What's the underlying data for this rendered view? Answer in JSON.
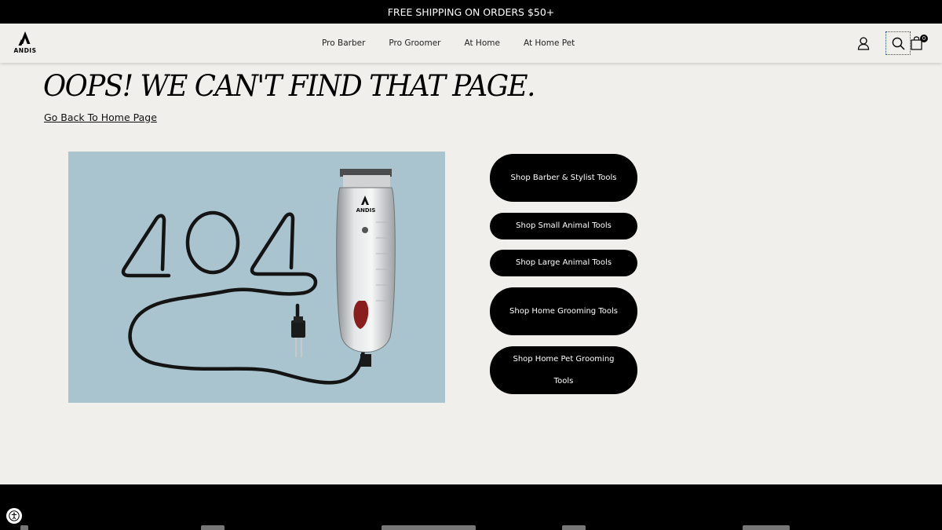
{
  "promo": {
    "text": "FREE SHIPPING ON ORDERS $50+"
  },
  "header": {
    "logo_text": "ANDIS",
    "nav": [
      "Pro Barber",
      "Pro Groomer",
      "At Home",
      "At Home Pet"
    ],
    "cart_count": "0"
  },
  "main": {
    "title": "OOPS! WE CAN'T FIND THAT PAGE.",
    "home_link": "Go Back To Home Page",
    "hero": {
      "number": "404",
      "brand": "ANDIS"
    },
    "shop_buttons": [
      "Shop Barber & Stylist Tools",
      "Shop Small Animal Tools",
      "Shop Large Animal Tools",
      "Shop Home Grooming Tools",
      "Shop Home Pet Grooming Tools"
    ]
  },
  "icons": {
    "account": "account-icon",
    "search": "search-icon",
    "cart": "cart-icon",
    "accessibility": "accessibility-icon"
  }
}
